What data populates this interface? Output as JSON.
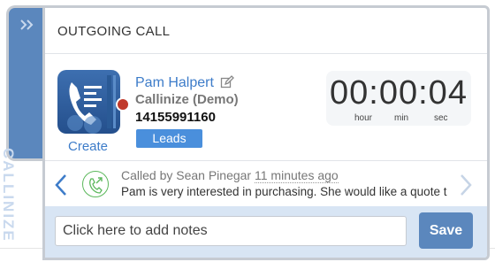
{
  "sidebar": {
    "brand": "CALLINIZE",
    "collapse_icon": "double-chevron-right-icon",
    "color": "#5b87bd"
  },
  "header": {
    "title": "OUTGOING CALL"
  },
  "contact": {
    "name": "Pam Halpert",
    "company": "Callinize (Demo)",
    "phone": "14155991160",
    "create_label": "Create",
    "leads_label": "Leads",
    "status_color": "#c0392b",
    "edit_icon": "pencil-edit-icon"
  },
  "timer": {
    "display": "00:00:04",
    "units": {
      "hour": "hour",
      "min": "min",
      "sec": "sec"
    }
  },
  "activity": {
    "called_by": "Called by Sean Pinegar",
    "time_ago": "11 minutes ago",
    "note": "Pam is very interested in purchasing. She would like a quote t",
    "prev_icon": "chevron-left-icon",
    "next_icon": "chevron-right-icon",
    "call_icon": "outgoing-call-icon"
  },
  "notes": {
    "placeholder": "Click here to add notes",
    "save_label": "Save"
  },
  "colors": {
    "accent": "#4a8fdc",
    "link": "#3d7cc9",
    "footer_bg": "#d8e5f4",
    "call_green": "#5cb85c"
  }
}
